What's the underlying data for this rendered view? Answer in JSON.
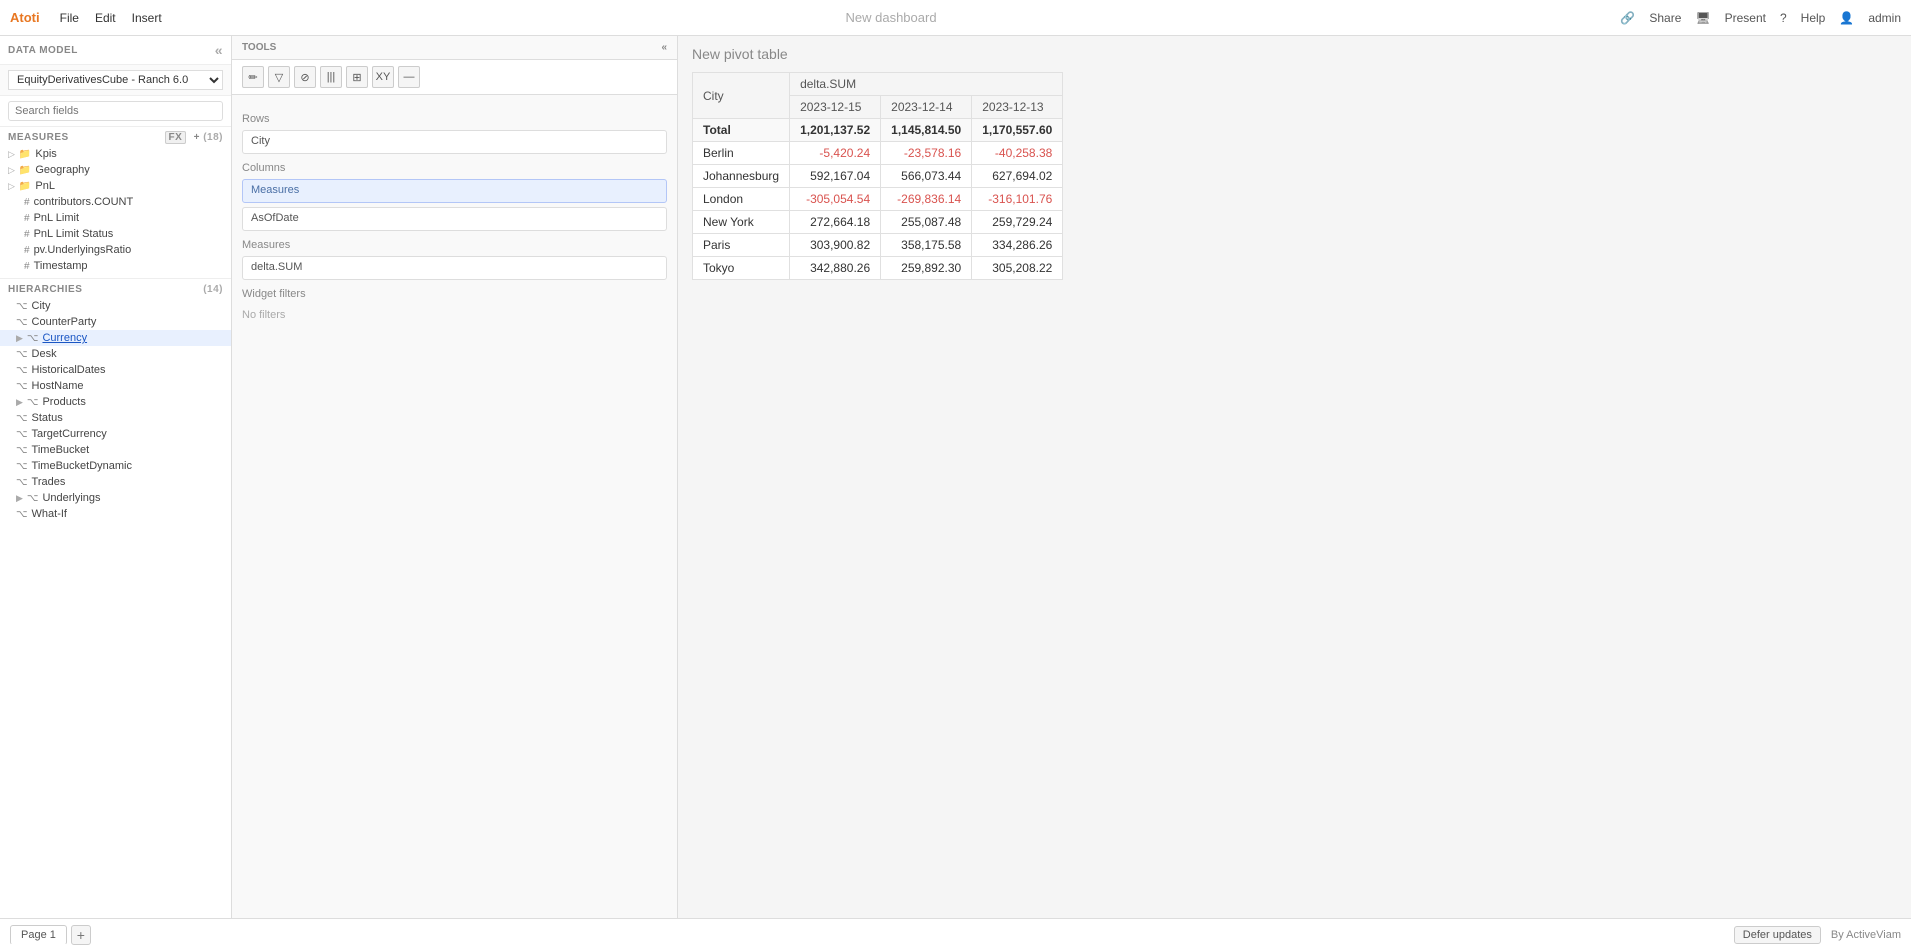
{
  "app": {
    "name": "Atoti",
    "title": "New dashboard"
  },
  "nav": {
    "file": "File",
    "edit": "Edit",
    "insert": "Insert",
    "share": "Share",
    "present": "Present",
    "help": "Help",
    "admin": "admin"
  },
  "dataModel": {
    "header": "DATA MODEL",
    "cube_label": "EquityDerivativesCube - Ranch 6.0",
    "search_placeholder": "Search fields",
    "measures_label": "MEASURES",
    "measures_count": "(18)",
    "fx_label": "fx",
    "items": [
      {
        "type": "folder",
        "label": "Kpis",
        "icon": "▷"
      },
      {
        "type": "folder",
        "label": "Geography",
        "icon": "▷"
      },
      {
        "type": "folder",
        "label": "PnL",
        "icon": "▷"
      },
      {
        "type": "measure",
        "label": "contributors.COUNT",
        "icon": "#"
      },
      {
        "type": "measure",
        "label": "PnL Limit",
        "icon": "#"
      },
      {
        "type": "measure",
        "label": "PnL Limit Status",
        "icon": "#"
      },
      {
        "type": "measure",
        "label": "pv.UnderlyingsRatio",
        "icon": "#"
      },
      {
        "type": "measure",
        "label": "Timestamp",
        "icon": "#"
      }
    ],
    "hierarchies_label": "HIERARCHIES",
    "hierarchies_count": "(14)",
    "hierarchies": [
      "City",
      "CounterParty",
      "Currency",
      "Desk",
      "HistoricalDates",
      "HostName",
      "Products",
      "Status",
      "TargetCurrency",
      "TimeBucket",
      "TimeBucketDynamic",
      "Trades",
      "Underlyings",
      "What-If"
    ]
  },
  "tools": {
    "header": "TOOLS",
    "toolbar_icons": [
      "✏",
      "▽",
      "⊘",
      "|||",
      "⊞",
      "XY",
      "—"
    ],
    "rows_label": "Rows",
    "rows_value": "City",
    "columns_label": "Columns",
    "columns_value1": "Measures",
    "columns_value2": "AsOfDate",
    "measures_label": "Measures",
    "measures_value": "delta.SUM",
    "widget_filters_label": "Widget filters",
    "no_filters": "No filters"
  },
  "pivot": {
    "title": "New pivot table",
    "col_city": "City",
    "col_delta": "delta.SUM",
    "date1": "2023-12-15",
    "date2": "2023-12-14",
    "date3": "2023-12-13",
    "rows": [
      {
        "label": "Total",
        "v1": "1,201,137.52",
        "v2": "1,145,814.50",
        "v3": "1,170,557.60",
        "neg1": false,
        "neg2": false,
        "neg3": false,
        "total": true
      },
      {
        "label": "Berlin",
        "v1": "-5,420.24",
        "v2": "-23,578.16",
        "v3": "-40,258.38",
        "neg1": true,
        "neg2": true,
        "neg3": true,
        "total": false
      },
      {
        "label": "Johannesburg",
        "v1": "592,167.04",
        "v2": "566,073.44",
        "v3": "627,694.02",
        "neg1": false,
        "neg2": false,
        "neg3": false,
        "total": false
      },
      {
        "label": "London",
        "v1": "-305,054.54",
        "v2": "-269,836.14",
        "v3": "-316,101.76",
        "neg1": true,
        "neg2": true,
        "neg3": true,
        "total": false
      },
      {
        "label": "New York",
        "v1": "272,664.18",
        "v2": "255,087.48",
        "v3": "259,729.24",
        "neg1": false,
        "neg2": false,
        "neg3": false,
        "total": false
      },
      {
        "label": "Paris",
        "v1": "303,900.82",
        "v2": "358,175.58",
        "v3": "334,286.26",
        "neg1": false,
        "neg2": false,
        "neg3": false,
        "total": false
      },
      {
        "label": "Tokyo",
        "v1": "342,880.26",
        "v2": "259,892.30",
        "v3": "305,208.22",
        "neg1": false,
        "neg2": false,
        "neg3": false,
        "total": false
      }
    ]
  },
  "bottomBar": {
    "page_label": "Page 1",
    "defer_updates": "Defer updates",
    "by_label": "By ActiveViam"
  }
}
